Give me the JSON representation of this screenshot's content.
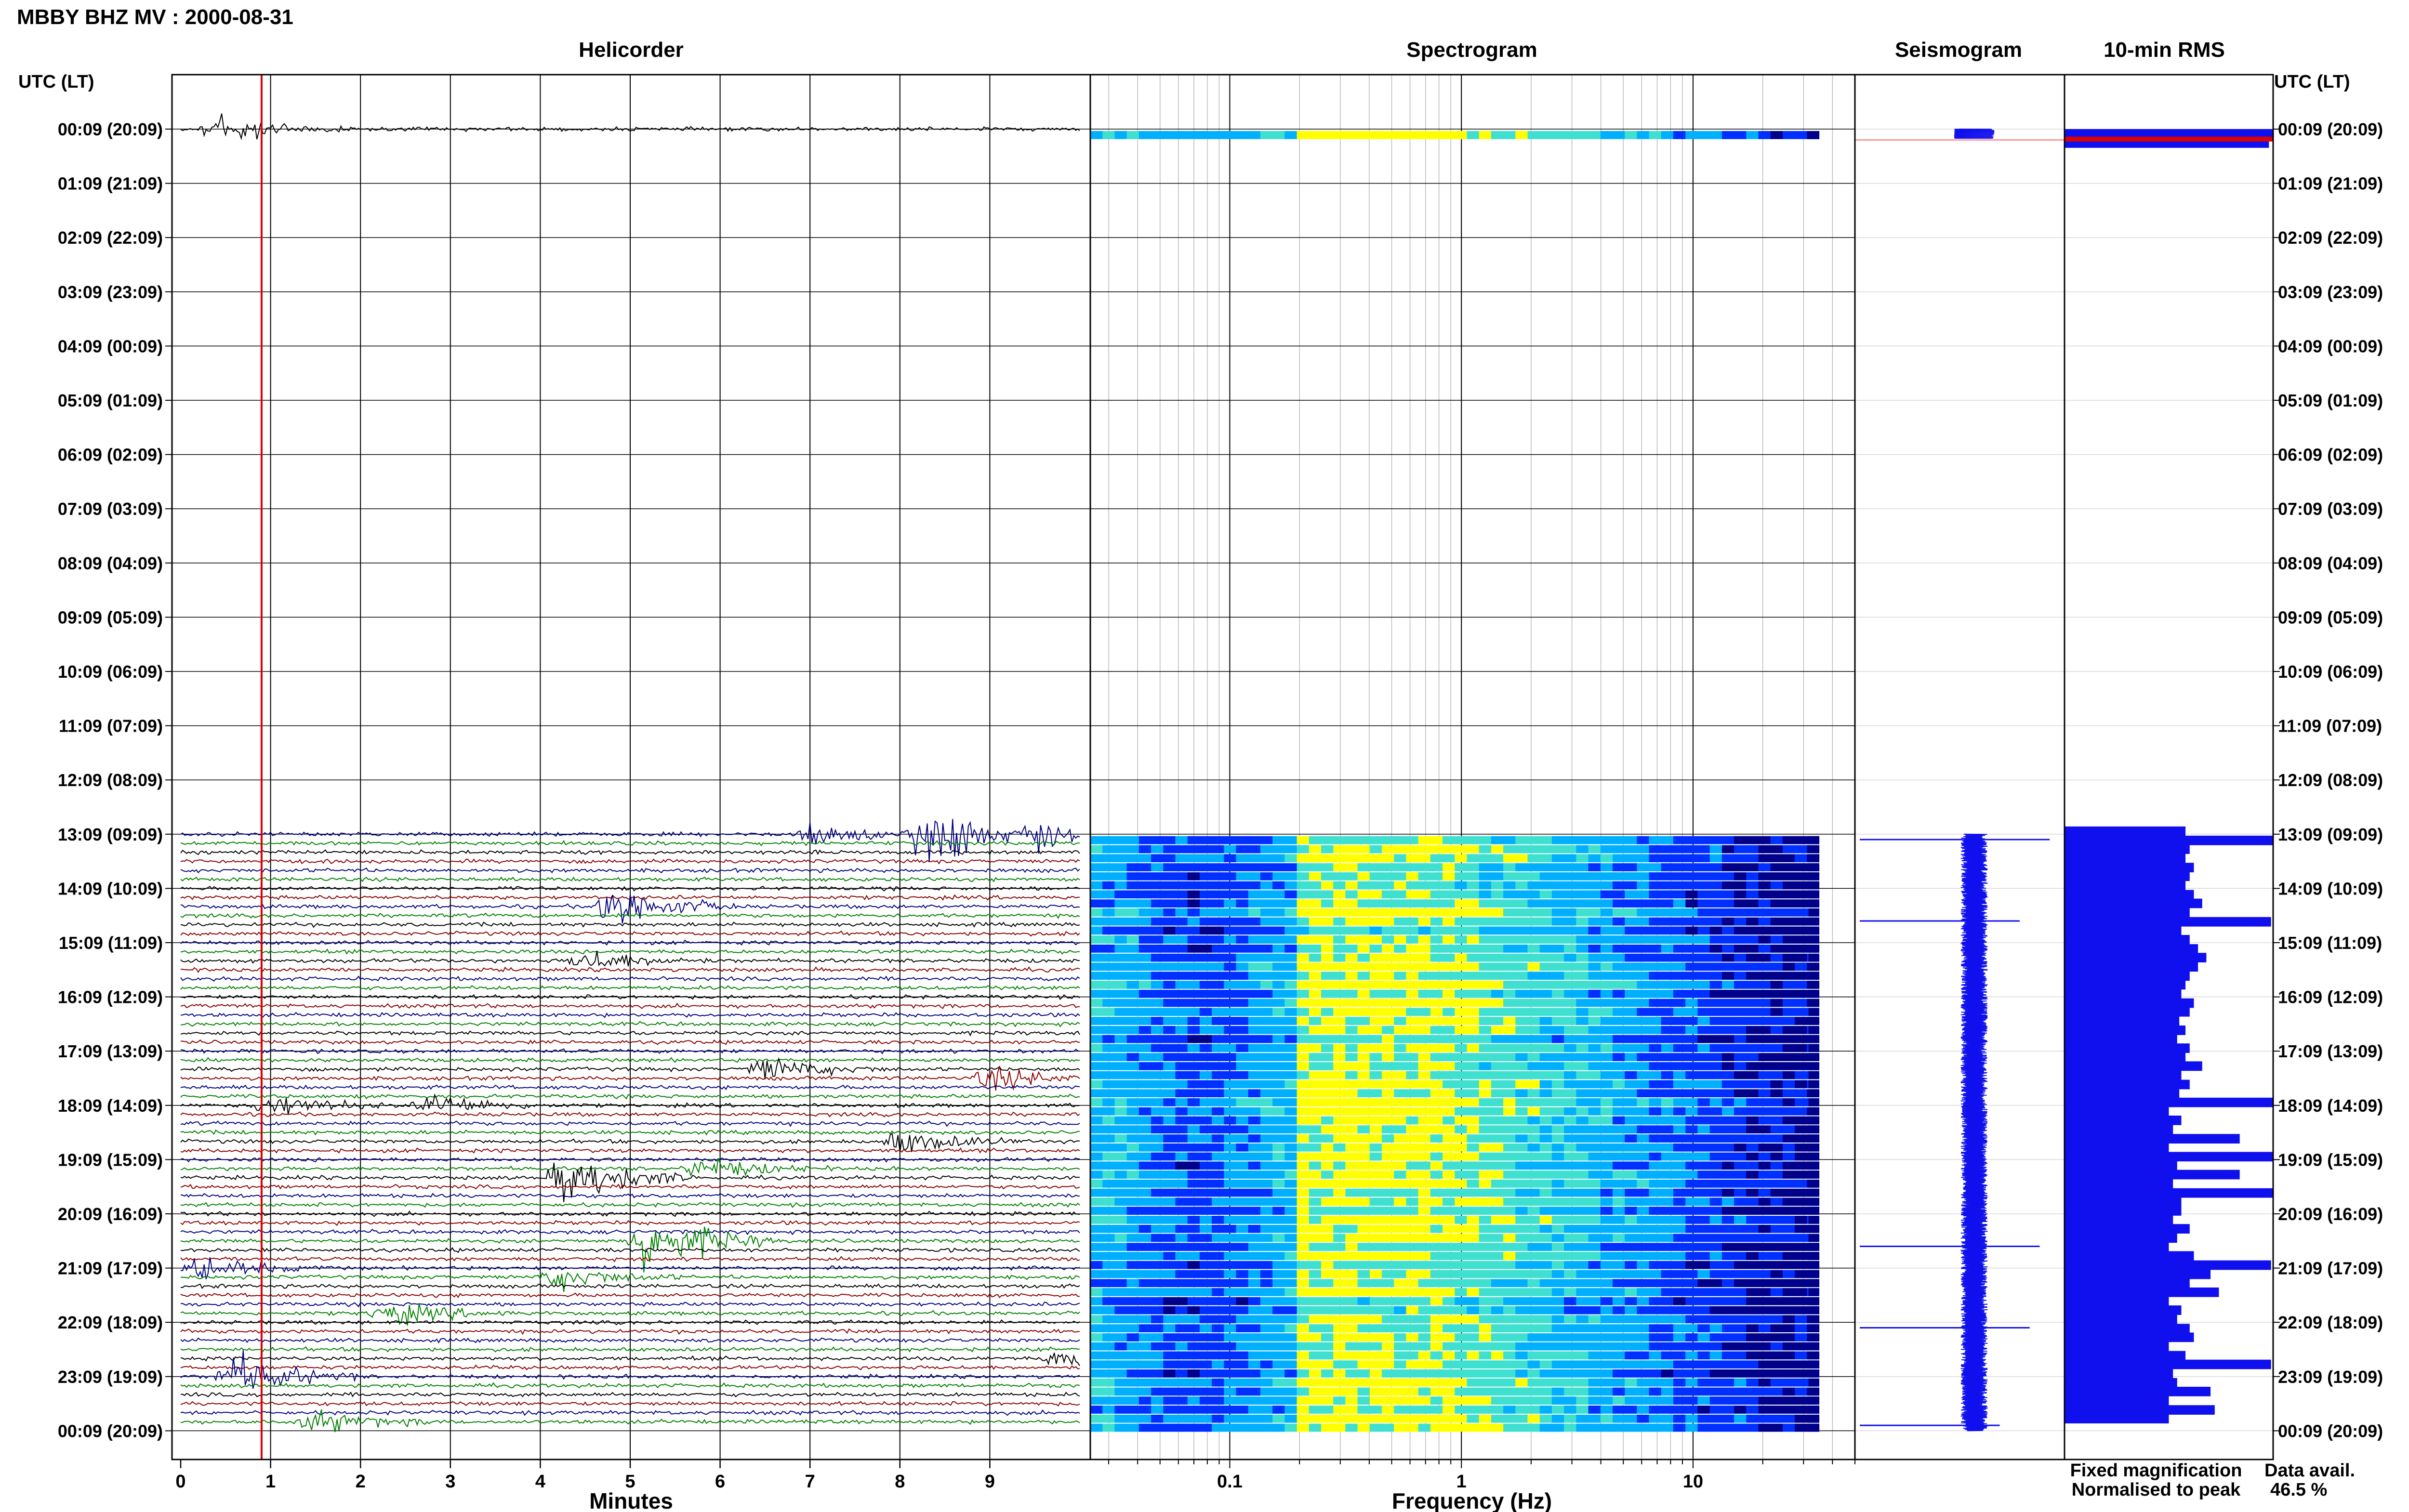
{
  "figure": {
    "title": "MBBY BHZ MV : 2000-08-31",
    "left_axis_header": "UTC (LT)",
    "right_axis_header": "UTC (LT)",
    "data_avail_label": "Data avail.",
    "data_avail_value": "46.5 %",
    "legend": [
      {
        "text": "Fixed magnification",
        "color": "#1414e6"
      },
      {
        "text": "Normalised to peak",
        "color": "#e61414"
      }
    ]
  },
  "colors": {
    "trace_cycle": [
      "#000000",
      "#8b0000",
      "#000080",
      "#008000"
    ],
    "rms_fill": "#1010ee",
    "peak_marker": "#dd0000",
    "spectrogram_colormap": [
      "#00008b",
      "#0030ff",
      "#00b0ff",
      "#40e0d0",
      "#ffff00"
    ]
  },
  "chart_data": [
    {
      "type": "line",
      "title": "Helicorder",
      "xlabel": "Minutes",
      "xlim": [
        0,
        10
      ],
      "xticks": [
        "0",
        "1",
        "2",
        "3",
        "4",
        "5",
        "6",
        "7",
        "8",
        "9"
      ],
      "xtick_values": [
        0,
        1,
        2,
        3,
        4,
        5,
        6,
        7,
        8,
        9
      ],
      "row_labels": [
        "00:09 (20:09)",
        "01:09 (21:09)",
        "02:09 (22:09)",
        "03:09 (23:09)",
        "04:09 (00:09)",
        "05:09 (01:09)",
        "06:09 (02:09)",
        "07:09 (03:09)",
        "08:09 (04:09)",
        "09:09 (05:09)",
        "10:09 (06:09)",
        "11:09 (07:09)",
        "12:09 (08:09)",
        "13:09 (09:09)",
        "14:09 (10:09)",
        "15:09 (11:09)",
        "16:09 (12:09)",
        "17:09 (13:09)",
        "18:09 (14:09)",
        "19:09 (15:09)",
        "20:09 (16:09)",
        "21:09 (17:09)",
        "22:09 (18:09)",
        "23:09 (19:09)",
        "00:09 (20:09)"
      ],
      "data_hours": [
        0,
        13,
        14,
        15,
        16,
        17,
        18,
        19,
        20,
        21,
        22,
        23
      ],
      "traces_per_hour": 6,
      "marker_minute": 0.9,
      "events": [
        {
          "hour": 0.0,
          "minute": 0.4,
          "amp": 3
        },
        {
          "hour": 13.0,
          "minute": 8.3,
          "amp": 6
        },
        {
          "hour": 13.0,
          "minute": 7.0,
          "amp": 2
        },
        {
          "hour": 13.0,
          "minute": 9.5,
          "amp": 2
        },
        {
          "hour": 14.3,
          "minute": 4.8,
          "amp": 4
        },
        {
          "hour": 15.3,
          "minute": 4.5,
          "amp": 2
        },
        {
          "hour": 17.3,
          "minute": 6.5,
          "amp": 2
        },
        {
          "hour": 17.5,
          "minute": 9.0,
          "amp": 2
        },
        {
          "hour": 18.0,
          "minute": 1.0,
          "amp": 2
        },
        {
          "hour": 18.0,
          "minute": 2.8,
          "amp": 2
        },
        {
          "hour": 18.7,
          "minute": 8.0,
          "amp": 2
        },
        {
          "hour": 19.3,
          "minute": 4.3,
          "amp": 5
        },
        {
          "hour": 19.2,
          "minute": 5.8,
          "amp": 2
        },
        {
          "hour": 20.5,
          "minute": 5.2,
          "amp": 6
        },
        {
          "hour": 21.0,
          "minute": 0.2,
          "amp": 2
        },
        {
          "hour": 21.2,
          "minute": 4.2,
          "amp": 2
        },
        {
          "hour": 21.8,
          "minute": 2.3,
          "amp": 2
        },
        {
          "hour": 22.7,
          "minute": 9.8,
          "amp": 2
        },
        {
          "hour": 23.0,
          "minute": 0.6,
          "amp": 4
        },
        {
          "hour": 23.8,
          "minute": 1.5,
          "amp": 2
        }
      ]
    },
    {
      "type": "heatmap",
      "title": "Spectrogram",
      "xlabel": "Frequency (Hz)",
      "xscale": "log",
      "xlim": [
        0.025,
        50
      ],
      "xticks": [
        "0.1",
        "1",
        "10"
      ],
      "xtick_values": [
        0.1,
        1,
        10
      ],
      "data_max_frequency": 35,
      "peak_frequency_band": [
        0.2,
        0.8
      ],
      "data_hours": [
        0,
        13,
        14,
        15,
        16,
        17,
        18,
        19,
        20,
        21,
        22,
        23
      ]
    },
    {
      "type": "line",
      "title": "Seismogram",
      "data_hours": [
        0,
        13,
        14,
        15,
        16,
        17,
        18,
        19,
        20,
        21,
        22,
        23
      ],
      "spikes": [
        {
          "hour": 13.1,
          "amp": 0.95
        },
        {
          "hour": 14.6,
          "amp": 0.8
        },
        {
          "hour": 20.6,
          "amp": 0.9
        },
        {
          "hour": 22.1,
          "amp": 0.85
        },
        {
          "hour": 23.9,
          "amp": 0.7
        }
      ]
    },
    {
      "type": "bar",
      "title": "10-min RMS",
      "orientation": "horizontal",
      "hours": [
        0.0,
        0.17,
        13.0,
        13.17,
        13.33,
        13.5,
        13.67,
        13.83,
        14.0,
        14.17,
        14.33,
        14.5,
        14.67,
        14.83,
        15.0,
        15.17,
        15.33,
        15.5,
        15.67,
        15.83,
        16.0,
        16.17,
        16.33,
        16.5,
        16.67,
        16.83,
        17.0,
        17.17,
        17.33,
        17.5,
        17.67,
        17.83,
        18.0,
        18.17,
        18.33,
        18.5,
        18.67,
        18.83,
        19.0,
        19.17,
        19.33,
        19.5,
        19.67,
        19.83,
        20.0,
        20.17,
        20.33,
        20.5,
        20.67,
        20.83,
        21.0,
        21.17,
        21.33,
        21.5,
        21.67,
        21.83,
        22.0,
        22.17,
        22.33,
        22.5,
        22.67,
        22.83,
        23.0,
        23.17,
        23.33,
        23.5,
        23.67,
        23.83
      ],
      "values": [
        1.0,
        0.98,
        0.58,
        1.0,
        0.6,
        0.58,
        0.62,
        0.6,
        0.58,
        0.62,
        0.66,
        0.6,
        0.99,
        0.56,
        0.6,
        0.64,
        0.68,
        0.64,
        0.6,
        0.58,
        0.56,
        0.62,
        0.6,
        0.55,
        0.58,
        0.54,
        0.6,
        0.58,
        0.66,
        0.56,
        0.6,
        0.55,
        1.0,
        0.5,
        0.56,
        0.52,
        0.84,
        0.5,
        1.0,
        0.54,
        0.84,
        0.52,
        1.0,
        0.56,
        0.56,
        0.52,
        0.6,
        0.54,
        0.5,
        0.62,
        0.99,
        0.7,
        0.6,
        0.74,
        0.5,
        0.56,
        0.54,
        0.6,
        0.62,
        0.5,
        0.58,
        0.99,
        0.52,
        0.54,
        0.7,
        0.5,
        0.72,
        0.5
      ],
      "xlim": [
        0,
        1
      ]
    }
  ]
}
